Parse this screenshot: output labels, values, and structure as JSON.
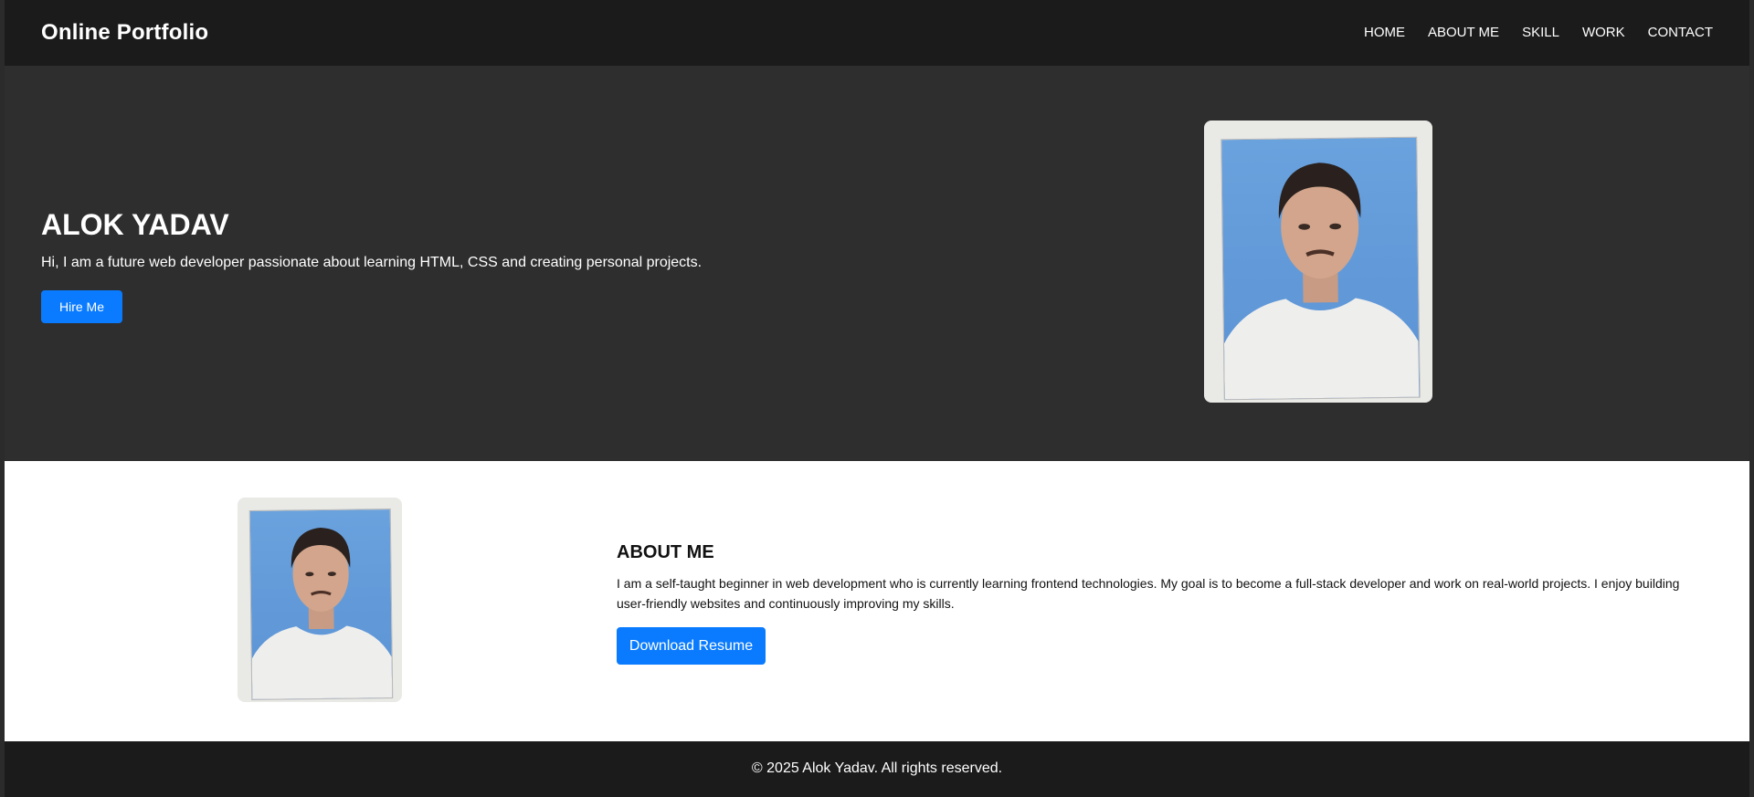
{
  "header": {
    "brand": "Online Portfolio",
    "nav": [
      "HOME",
      "ABOUT ME",
      "SKILL",
      "WORK",
      "CONTACT"
    ]
  },
  "hero": {
    "title": "ALOK YADAV",
    "text": "Hi, I am a future web developer passionate about learning HTML, CSS and creating personal projects.",
    "button": "Hire Me"
  },
  "about": {
    "title": "ABOUT ME",
    "text": "I am a self-taught beginner in web development who is currently learning frontend technologies. My goal is to become a full-stack developer and work on real-world projects. I enjoy building user-friendly websites and continuously improving my skills.",
    "button": "Download Resume"
  },
  "footer": {
    "text": "© 2025 Alok Yadav. All rights reserved."
  },
  "colors": {
    "accent": "#0a7bff",
    "header_bg": "#1b1b1b",
    "hero_bg": "#2e2e2e",
    "about_bg": "#ffffff"
  }
}
